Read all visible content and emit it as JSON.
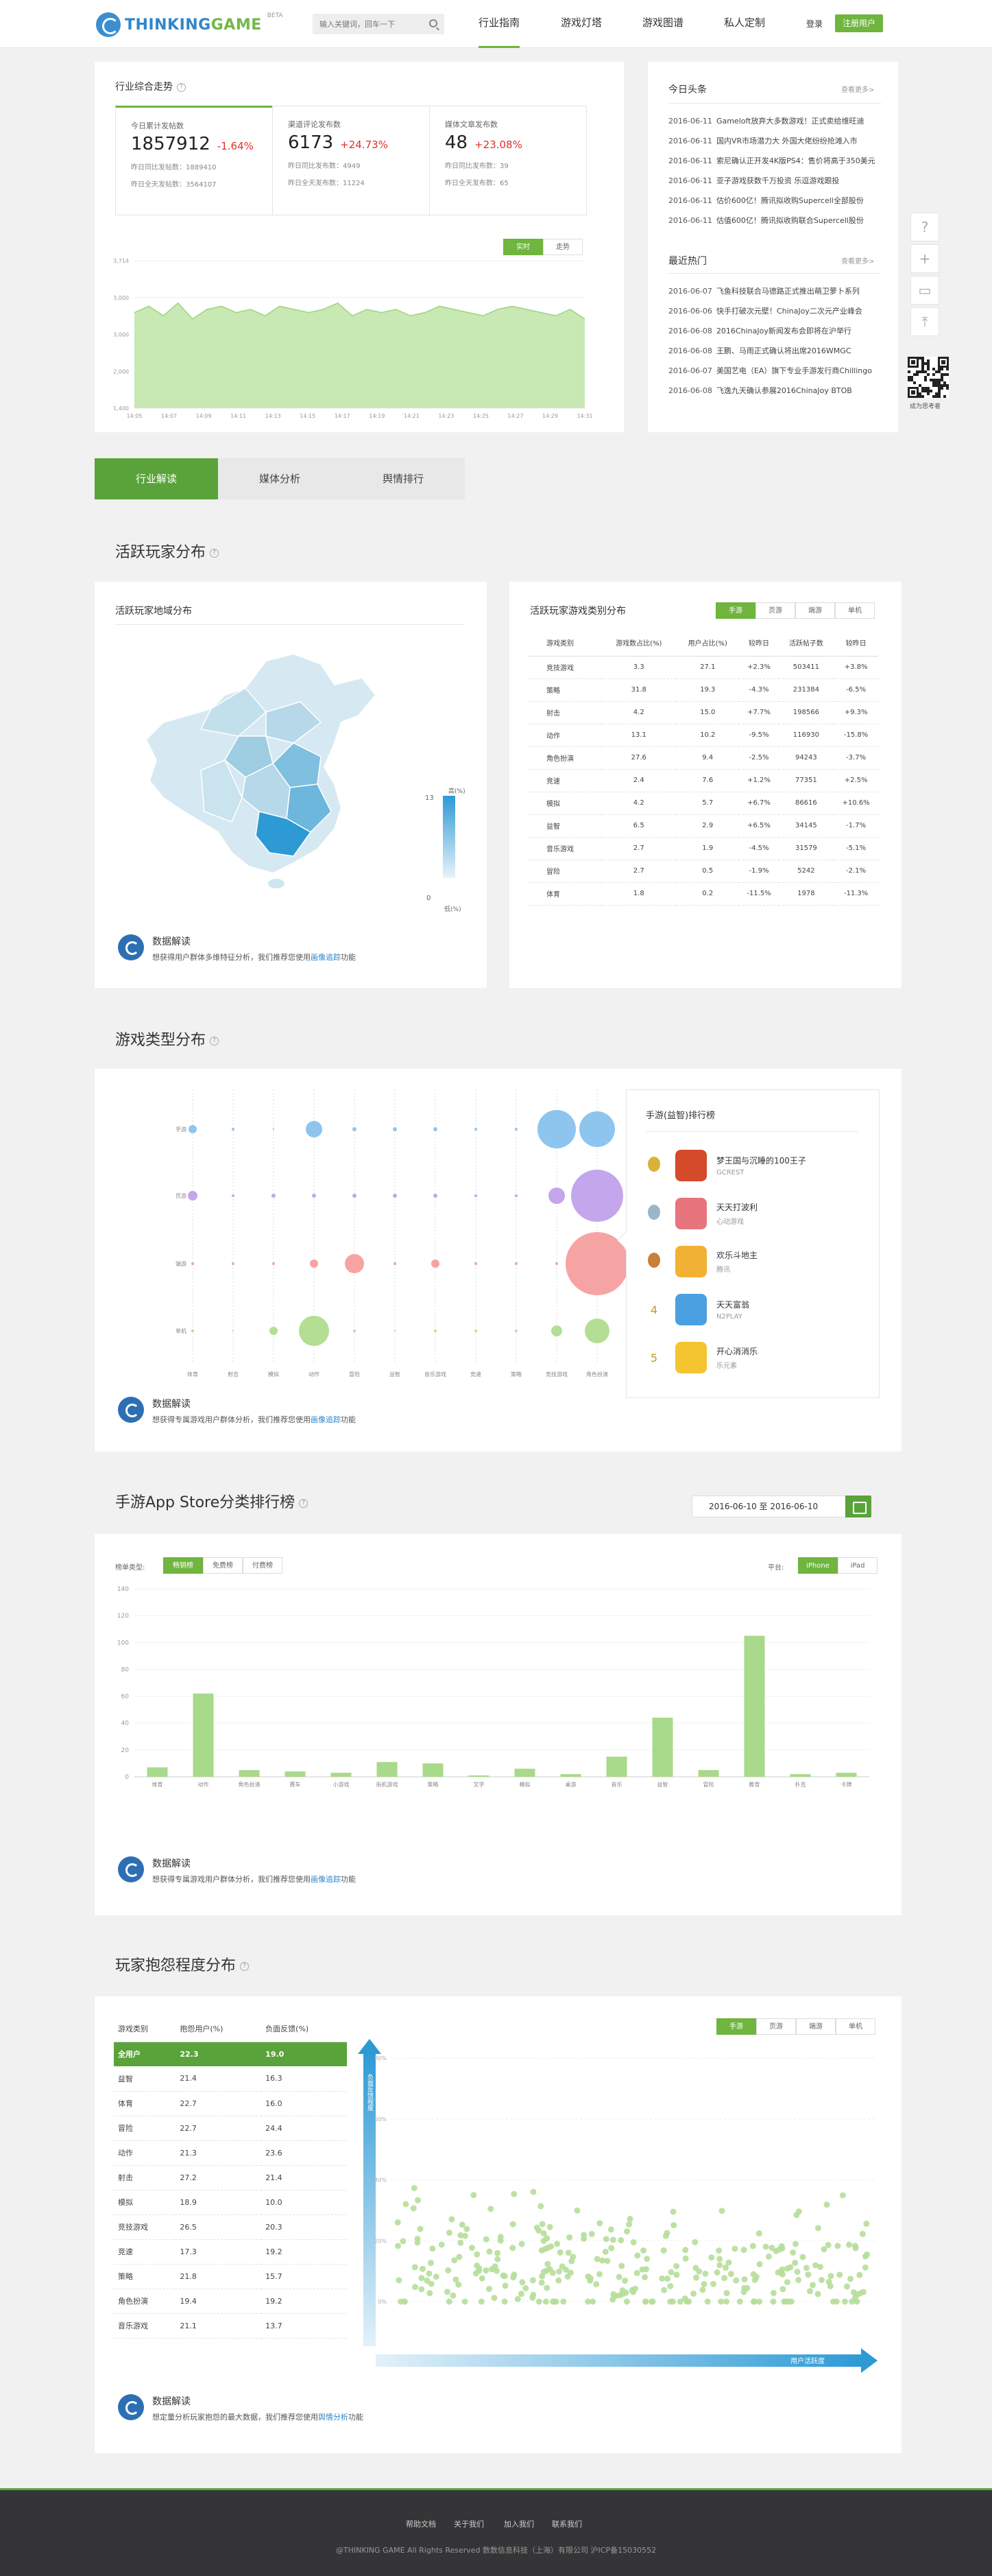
{
  "header": {
    "logo_main": "THINKING",
    "logo_accent": "GAME",
    "beta": "BETA",
    "search_placeholder": "输入关键词，回车一下",
    "nav": [
      "行业指南",
      "游戏灯塔",
      "游戏图谱",
      "私人定制"
    ],
    "login": "登录",
    "register": "注册用户"
  },
  "trend": {
    "title": "行业综合走势",
    "stats": [
      {
        "label": "今日累计发帖数",
        "value": "1857912",
        "change": "-1.64%",
        "sub1": "昨日同比发帖数：1889410",
        "sub2": "昨日全天发帖数：3564107"
      },
      {
        "label": "渠道评论发布数",
        "value": "6173",
        "change": "+24.73%",
        "sub1": "昨日同比发布数：4949",
        "sub2": "昨日全天发布数：11224"
      },
      {
        "label": "媒体文章发布数",
        "value": "48",
        "change": "+23.08%",
        "sub1": "昨日同比发布数：39",
        "sub2": "昨日全天发布数：65"
      }
    ],
    "toggle": [
      "实时",
      "走势"
    ],
    "chart_data": {
      "type": "area",
      "x": [
        "14:05",
        "14:07",
        "14:09",
        "14:11",
        "14:13",
        "14:15",
        "14:17",
        "14:19",
        "14:21",
        "14:23",
        "14:25",
        "14:27",
        "14:29",
        "14:31"
      ],
      "y_ticks": [
        "1,400",
        "2,000",
        "3,000",
        "3,000",
        "3,714"
      ],
      "values": [
        2900,
        3000,
        2850,
        3050,
        2800,
        2950,
        3000,
        2900,
        2950,
        2850,
        3000,
        2950,
        2900,
        2950,
        3050,
        2850,
        2950,
        2900,
        2950,
        2850,
        2900,
        3000,
        2950,
        2900,
        2850,
        2950,
        3000,
        2950,
        2900,
        2850,
        2950,
        2800
      ],
      "ylim": [
        1400,
        3714
      ],
      "colors": {
        "fill": "#c8e8b4",
        "line": "#9fd47e"
      }
    }
  },
  "news": {
    "headline_title": "今日头条",
    "more": "查看更多>",
    "headlines": [
      {
        "date": "2016-06-11",
        "text": "Gameloft放弃大多数游戏！正式卖给维旺迪"
      },
      {
        "date": "2016-06-11",
        "text": "国内VR市场潜力大 外国大佬纷纷抢滩入市"
      },
      {
        "date": "2016-06-11",
        "text": "索尼确认正开发4K版PS4：售价将高于350美元"
      },
      {
        "date": "2016-06-11",
        "text": "亚子游戏获数千万投资 乐逗游戏跟投"
      },
      {
        "date": "2016-06-11",
        "text": "估价600亿！腾讯拟收购Supercell全部股份"
      },
      {
        "date": "2016-06-11",
        "text": "估值600亿！腾讯拟收购联合Supercell股份"
      }
    ],
    "hot_title": "最近热门",
    "hot": [
      {
        "date": "2016-06-07",
        "text": "飞鱼科技联合马德路正式推出萌卫萝卜系列"
      },
      {
        "date": "2016-06-06",
        "text": "快手打破次元壁！ChinaJoy二次元产业峰会"
      },
      {
        "date": "2016-06-08",
        "text": "2016ChinaJoy新闻发布会即将在沪举行"
      },
      {
        "date": "2016-06-08",
        "text": "王鹏、马雨正式确认将出席2016WMGC"
      },
      {
        "date": "2016-06-07",
        "text": "美国艺电（EA）旗下专业手游发行商Chillingo"
      },
      {
        "date": "2016-06-08",
        "text": "飞逸九天确认参展2016ChinaJoy BTOB"
      }
    ]
  },
  "qr_label": "成为思考者",
  "tabs": [
    "行业解读",
    "媒体分析",
    "舆情排行"
  ],
  "active_players": {
    "title": "活跃玩家分布",
    "map_title": "活跃玩家地域分布",
    "legend_high": "高(%)",
    "legend_low": "低(%)",
    "legend_max": "13",
    "legend_min": "0",
    "type_title": "活跃玩家游戏类别分布",
    "filters": [
      "手游",
      "页游",
      "端游",
      "单机"
    ],
    "columns": [
      "游戏类别",
      "游戏数占比(%)",
      "用户占比(%)",
      "较昨日",
      "活跃帖子数",
      "较昨日"
    ],
    "rows": [
      [
        "竞技游戏",
        "3.3",
        "27.1",
        "+2.3%",
        "503411",
        "+3.8%"
      ],
      [
        "策略",
        "31.8",
        "19.3",
        "-4.3%",
        "231384",
        "-6.5%"
      ],
      [
        "射击",
        "4.2",
        "15.0",
        "+7.7%",
        "198566",
        "+9.3%"
      ],
      [
        "动作",
        "13.1",
        "10.2",
        "-9.5%",
        "116930",
        "-15.8%"
      ],
      [
        "角色扮演",
        "27.6",
        "9.4",
        "-2.5%",
        "94243",
        "-3.7%"
      ],
      [
        "竞速",
        "2.4",
        "7.6",
        "+1.2%",
        "77351",
        "+2.5%"
      ],
      [
        "模拟",
        "4.2",
        "5.7",
        "+6.7%",
        "86616",
        "+10.6%"
      ],
      [
        "益智",
        "6.5",
        "2.9",
        "+6.5%",
        "34145",
        "-1.7%"
      ],
      [
        "音乐游戏",
        "2.7",
        "1.9",
        "-4.5%",
        "31579",
        "-5.1%"
      ],
      [
        "冒险",
        "2.7",
        "0.5",
        "-1.9%",
        "5242",
        "-2.1%"
      ],
      [
        "体育",
        "1.8",
        "0.2",
        "-11.5%",
        "1978",
        "-11.3%"
      ]
    ],
    "interp_title": "数据解读",
    "interp_desc": "想获得用户群体多维特征分析，我们推荐您使用",
    "interp_link": "画像追踪",
    "interp_tail": "功能"
  },
  "game_types": {
    "title": "游戏类型分布",
    "row_labels": [
      "手游",
      "页游",
      "端游",
      "单机"
    ],
    "col_labels": [
      "体育",
      "射击",
      "模拟",
      "动作",
      "冒险",
      "益智",
      "音乐游戏",
      "竞速",
      "策略",
      "竞技游戏",
      "角色扮演"
    ],
    "chart_data": {
      "type": "scatter",
      "rows": [
        "手游",
        "页游",
        "端游",
        "单机"
      ],
      "cols": [
        "体育",
        "射击",
        "模拟",
        "动作",
        "冒险",
        "益智",
        "音乐游戏",
        "竞速",
        "策略",
        "竞技游戏",
        "角色扮演"
      ],
      "sizes": [
        [
          6,
          1,
          0,
          12,
          3,
          3,
          3,
          1,
          1,
          28,
          26
        ],
        [
          7,
          1,
          3,
          3,
          3,
          3,
          3,
          1,
          1,
          12,
          38
        ],
        [
          1,
          1,
          2,
          6,
          14,
          1,
          6,
          1,
          1,
          2,
          46
        ],
        [
          2,
          0,
          6,
          22,
          2,
          0,
          1,
          1,
          1,
          8,
          18
        ]
      ],
      "colors": [
        "#8dc5ef",
        "#c3a6ec",
        "#f6a3a3",
        "#b4de93"
      ]
    },
    "rank_title": "手游(益智)排行榜",
    "rank": [
      {
        "no": "1",
        "name": "梦王国与沉睡的100王子",
        "company": "GCREST",
        "color": "#d44a2a"
      },
      {
        "no": "2",
        "name": "天天打波利",
        "company": "心动游戏",
        "color": "#e8757e"
      },
      {
        "no": "3",
        "name": "欢乐斗地主",
        "company": "腾讯",
        "color": "#f0b134"
      },
      {
        "no": "4",
        "name": "天天富翁",
        "company": "N2PLAY",
        "color": "#4aa0e0"
      },
      {
        "no": "5",
        "name": "开心消消乐",
        "company": "乐元素",
        "color": "#f4c431"
      }
    ],
    "interp_title": "数据解读",
    "interp_desc": "想获得专属游戏用户群体分析，我们推荐您使用",
    "interp_link": "画像追踪",
    "interp_tail": "功能"
  },
  "appstore": {
    "title": "手游App Store分类排行榜",
    "date": "2016-06-10 至 2016-06-10",
    "list_type_label": "榜单类型:",
    "list_types": [
      "畅销榜",
      "免费榜",
      "付费榜"
    ],
    "platform_label": "平台:",
    "platforms": [
      "iPhone",
      "iPad"
    ],
    "chart_data": {
      "type": "bar",
      "categories": [
        "体育",
        "动作",
        "角色扮演",
        "赛车",
        "小游戏",
        "街机游戏",
        "策略",
        "文字",
        "模拟",
        "桌游",
        "音乐",
        "益智",
        "冒险",
        "教育",
        "扑克",
        "卡牌"
      ],
      "values": [
        7,
        62,
        5,
        4,
        3,
        11,
        10,
        1,
        6,
        2,
        15,
        44,
        5,
        105,
        2,
        3
      ],
      "ylim": [
        0,
        140
      ],
      "y_ticks": [
        "0",
        "20",
        "40",
        "60",
        "80",
        "100",
        "120",
        "140"
      ],
      "colors": {
        "bar": "#a9d98a"
      }
    },
    "interp_title": "数据解读",
    "interp_desc": "想获得专属游戏用户群体分析，我们推荐您使用",
    "interp_link": "画像追踪",
    "interp_tail": "功能"
  },
  "complaint": {
    "title": "玩家抱怨程度分布",
    "columns": [
      "游戏类别",
      "抱怨用户(%)",
      "负面反馈(%)"
    ],
    "rows": [
      [
        "全用户",
        "22.3",
        "19.0"
      ],
      [
        "益智",
        "21.4",
        "16.3"
      ],
      [
        "体育",
        "22.7",
        "16.0"
      ],
      [
        "冒险",
        "22.7",
        "24.4"
      ],
      [
        "动作",
        "21.3",
        "23.6"
      ],
      [
        "射击",
        "27.2",
        "21.4"
      ],
      [
        "模拟",
        "18.9",
        "10.0"
      ],
      [
        "竞技游戏",
        "26.5",
        "20.3"
      ],
      [
        "竞速",
        "17.3",
        "19.2"
      ],
      [
        "策略",
        "21.8",
        "15.7"
      ],
      [
        "角色扮演",
        "19.4",
        "19.2"
      ],
      [
        "音乐游戏",
        "21.1",
        "13.7"
      ]
    ],
    "filters": [
      "手游",
      "页游",
      "端游",
      "单机"
    ],
    "y_axis_label": "负面反馈程度",
    "x_axis_label": "用户活跃度",
    "chart_data": {
      "type": "scatter",
      "y_ticks": [
        "0%",
        "20%",
        "40%",
        "60%",
        "80%"
      ],
      "ylim": [
        0,
        80
      ],
      "colors": {
        "point": "#b6de9a"
      }
    },
    "interp_title": "数据解读",
    "interp_desc": "想定量分析玩家抱怨的最大数据，我们推荐您使用",
    "interp_link": "舆情分析",
    "interp_tail": "功能"
  },
  "footer": {
    "links": [
      "帮助文档",
      "关于我们",
      "加入我们",
      "联系我们"
    ],
    "copyright": "@THINKING GAME All Rights Reserved 数数信息科技（上海）有限公司 沪ICP备15030552"
  }
}
